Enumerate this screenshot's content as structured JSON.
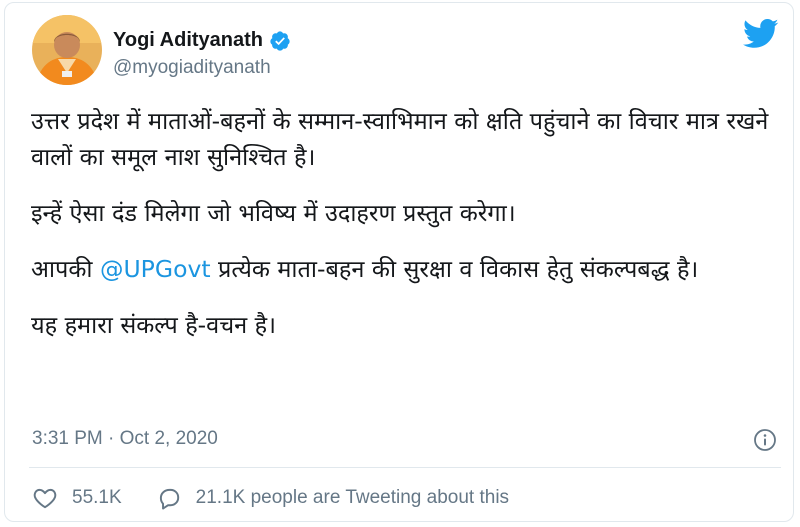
{
  "author": {
    "display_name": "Yogi Adityanath",
    "handle": "@myogiadityanath"
  },
  "tweet": {
    "para1": "उत्तर प्रदेश में माताओं-बहनों के सम्मान-स्वाभिमान को क्षति पहुंचाने का विचार मात्र रखने वालों का समूल नाश सुनिश्चित है।",
    "para2": "इन्हें ऐसा दंड मिलेगा जो भविष्य में उदाहरण प्रस्तुत करेगा।",
    "para3_prefix": "आपकी ",
    "para3_mention": "@UPGovt",
    "para3_suffix": " प्रत्येक माता-बहन की सुरक्षा व विकास हेतु संकल्पबद्ध है।",
    "para4": "यह हमारा संकल्प है-वचन है।"
  },
  "timestamp": "3:31 PM · Oct 2, 2020",
  "actions": {
    "likes": "55.1K",
    "tweeting_about": "21.1K people are Tweeting about this"
  },
  "colors": {
    "accent": "#1da1f2",
    "mention": "#1b95e0",
    "muted": "#657786",
    "border": "#e1e8ed"
  },
  "icons": [
    "verified-badge-icon",
    "twitter-bird-icon",
    "info-icon",
    "heart-icon",
    "comment-icon"
  ]
}
